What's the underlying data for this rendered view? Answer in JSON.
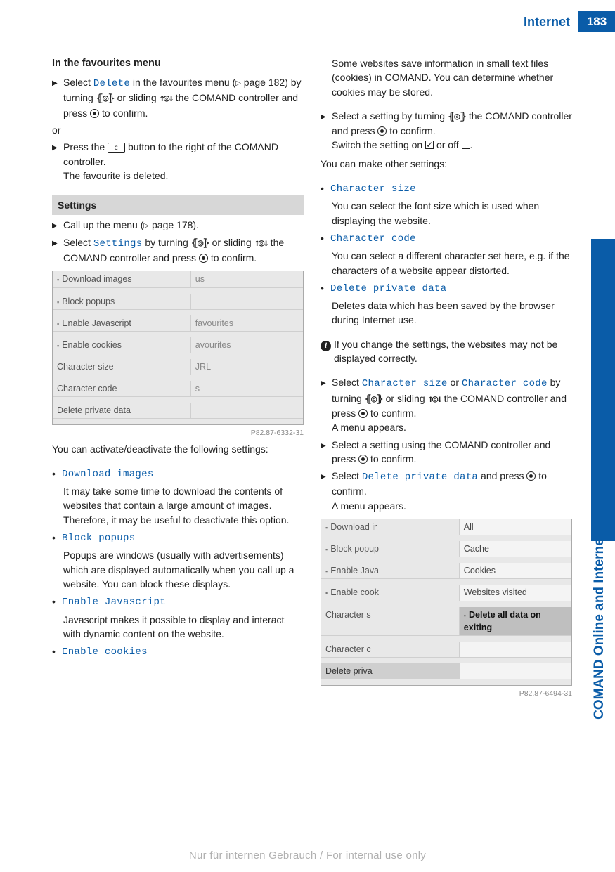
{
  "header": {
    "title": "Internet",
    "page": "183"
  },
  "side": {
    "label": "COMAND Online and Internet"
  },
  "left": {
    "h1": "In the favourites menu",
    "s1a": "Select ",
    "s1_delete": "Delete",
    "s1b": " in the favourites menu (",
    "s1_xref": " page 182) by turning ",
    "s1_turn": "⦃◎⦄",
    "s1c": " or sliding ",
    "s1_slide": "↑◎↓",
    "s1d": " the COMAND controller and press ",
    "s1e": " to confirm.",
    "or": "or",
    "s2a": "Press the ",
    "s2_key": "c",
    "s2b": " button to the right of the COMAND controller.",
    "s2c": "The favourite is deleted.",
    "section": "Settings",
    "s3": "Call up the menu (",
    "s3_xref": " page 178).",
    "s4a": "Select ",
    "s4_settings": "Settings",
    "s4b": " by turning ",
    "s4c": " or sliding ",
    "s4d": " the COMAND controller and press ",
    "s4e": " to confirm.",
    "shot1": {
      "rows": [
        {
          "l": "Download images",
          "r": "us",
          "chk": true
        },
        {
          "l": "Block popups",
          "r": "",
          "chk": true
        },
        {
          "l": "Enable Javascript",
          "r": "favourites",
          "chk": true
        },
        {
          "l": "Enable cookies",
          "r": "avourites",
          "chk": true
        },
        {
          "l": "Character size",
          "r": "JRL",
          "chk": false
        },
        {
          "l": "Character code",
          "r": "s",
          "chk": false
        },
        {
          "l": "Delete private data",
          "r": "",
          "chk": false
        }
      ],
      "label": "P82.87-6332-31"
    },
    "intro2": "You can activate/deactivate the following settings:",
    "b1_t": "Download images",
    "b1": "It may take some time to download the contents of websites that contain a large amount of images. Therefore, it may be useful to deactivate this option.",
    "b2_t": "Block popups",
    "b2": "Popups are windows (usually with advertisements) which are displayed automatically when you call up a website. You can block these displays.",
    "b3_t": "Enable Javascript",
    "b3": "Javascript makes it possible to display and interact with dynamic content on the website.",
    "b4_t": "Enable cookies"
  },
  "right": {
    "p1": "Some websites save information in small text files (cookies) in COMAND. You can determine whether cookies may be stored.",
    "s5a": "Select a setting by turning ",
    "s5b": " the COMAND controller and press ",
    "s5c": " to confirm.",
    "s5d": "Switch the setting on ",
    "s5e": " or off ",
    "s5f": ".",
    "p2": "You can make other settings:",
    "b5_t": "Character size",
    "b5": "You can select the font size which is used when displaying the website.",
    "b6_t": "Character code",
    "b6": "You can select a different character set here, e.g. if the characters of a website appear distorted.",
    "b7_t": "Delete private data",
    "b7": "Deletes data which has been saved by the browser during Internet use.",
    "info": "If you change the settings, the websites may not be displayed correctly.",
    "s6a": "Select ",
    "s6_cs": "Character size",
    "s6b": " or ",
    "s6_cc": "Character code",
    "s6c": " by turning ",
    "s6d": " or sliding ",
    "s6e": " the COMAND controller and press ",
    "s6f": " to confirm.",
    "s6g": "A menu appears.",
    "s7a": "Select a setting using the COMAND controller and press ",
    "s7b": " to confirm.",
    "s8a": "Select ",
    "s8_dpd": "Delete private data",
    "s8b": " and press ",
    "s8c": " to confirm.",
    "s8d": "A menu appears.",
    "shot2": {
      "left": [
        {
          "t": "Download ir",
          "chk": true
        },
        {
          "t": "Block popup",
          "chk": true
        },
        {
          "t": "Enable Java",
          "chk": true
        },
        {
          "t": "Enable cook",
          "chk": true
        },
        {
          "t": "Character s",
          "chk": false
        },
        {
          "t": "Character c",
          "chk": false
        },
        {
          "t": "Delete priva",
          "chk": false,
          "sel": true
        }
      ],
      "right": [
        {
          "t": "All"
        },
        {
          "t": "Cache"
        },
        {
          "t": "Cookies"
        },
        {
          "t": "Websites visited"
        },
        {
          "t": "Delete all data on exiting",
          "hl": true,
          "chk": true
        }
      ],
      "label": "P82.87-6494-31"
    }
  },
  "footer": "Nur für internen Gebrauch / For internal use only"
}
